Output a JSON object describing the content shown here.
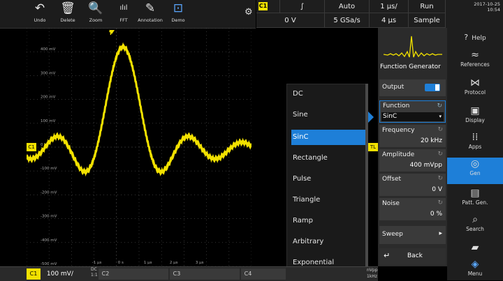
{
  "toolbar": {
    "buttons": [
      {
        "label": "Undo",
        "icon": "undo-icon",
        "glyph": "↶"
      },
      {
        "label": "Delete",
        "icon": "trash-icon",
        "glyph": "🗑"
      },
      {
        "label": "Zoom",
        "icon": "zoom-icon",
        "glyph": "🔍"
      },
      {
        "label": "FFT",
        "icon": "fft-icon",
        "glyph": "ılıl"
      },
      {
        "label": "Annotation",
        "icon": "pencil-icon",
        "glyph": "✎"
      },
      {
        "label": "Demo",
        "icon": "demo-icon",
        "glyph": "⊡"
      }
    ],
    "gear_glyph": "⚙"
  },
  "status": {
    "channel": "C1",
    "trigger_slope": "∫",
    "trigger_mode": "Auto",
    "time_per_div": "1 µs/",
    "run_state": "Run",
    "trigger_level": "0 V",
    "sample_rate": "5 GSa/s",
    "record_time": "4 µs",
    "acq_mode": "Sample"
  },
  "datetime": {
    "date": "2017-10-25",
    "time": "10:54"
  },
  "waveform": {
    "trace_color": "#f2e100",
    "y_labels": [
      "400 mV",
      "300 mV",
      "200 mV",
      "100 mV",
      "0 V",
      "-100 mV",
      "-200 mV",
      "-300 mV",
      "-400 mV",
      "-500 mV"
    ],
    "x_labels": [
      "-1 µs",
      "0 s",
      "1 µs",
      "2 µs",
      "3 µs"
    ],
    "marker_left": "C1",
    "marker_right": "TL",
    "trigger_marker": "T"
  },
  "function_menu": {
    "items": [
      "DC",
      "Sine",
      "SinC",
      "Rectangle",
      "Pulse",
      "Triangle",
      "Ramp",
      "Arbitrary",
      "Exponential"
    ],
    "selected": "SinC"
  },
  "panel": {
    "title": "Function Generator",
    "output_label": "Output",
    "function_label": "Function",
    "function_value": "SinC",
    "frequency_label": "Frequency",
    "frequency_value": "20 kHz",
    "amplitude_label": "Amplitude",
    "amplitude_value": "400 mVpp",
    "offset_label": "Offset",
    "offset_value": "0 V",
    "noise_label": "Noise",
    "noise_value": "0 %",
    "sweep_label": "Sweep",
    "back_label": "Back"
  },
  "nav": [
    {
      "label": "Help",
      "glyph": "?",
      "icon": "help-icon"
    },
    {
      "label": "References",
      "glyph": "≈",
      "icon": "references-icon"
    },
    {
      "label": "Protocol",
      "glyph": "⋈",
      "icon": "protocol-icon"
    },
    {
      "label": "Display",
      "glyph": "▣",
      "icon": "display-icon"
    },
    {
      "label": "Apps",
      "glyph": "⁞⁞",
      "icon": "apps-icon"
    },
    {
      "label": "Gen",
      "glyph": "◎",
      "icon": "generator-icon"
    },
    {
      "label": "Patt. Gen.",
      "glyph": "▤",
      "icon": "pattern-generator-icon"
    },
    {
      "label": "Search",
      "glyph": "⌕",
      "icon": "search-icon"
    },
    {
      "label": "",
      "glyph": "▰",
      "icon": "folder-icon"
    },
    {
      "label": "Menu",
      "glyph": "◈",
      "icon": "menu-icon"
    }
  ],
  "bottom": {
    "c1_label": "C1",
    "c1_scale": "100 mV/",
    "c1_coupling_top": "DC",
    "c1_coupling_bottom": "1:1",
    "c2_label": "C2",
    "c3_label": "C3",
    "c4_label": "C4",
    "gen_top": "nVpp",
    "gen_bottom": "1kHz"
  }
}
